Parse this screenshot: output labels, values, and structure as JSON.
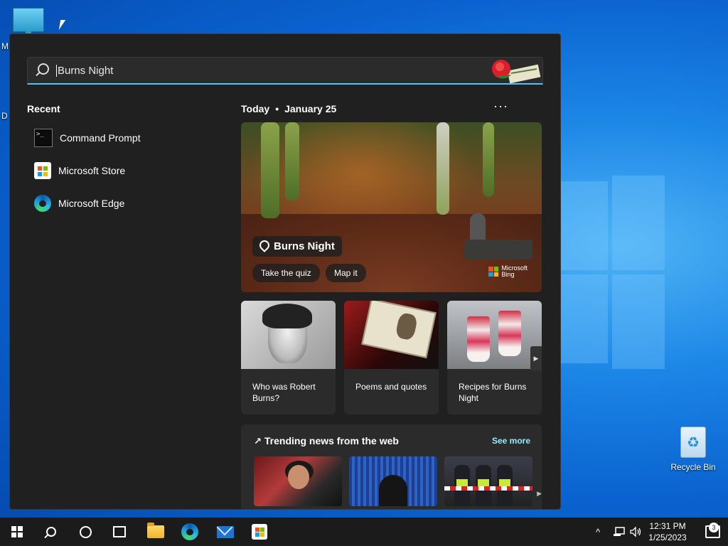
{
  "desktop": {
    "edge_letters": [
      "M",
      "D"
    ],
    "recycle_bin_label": "Recycle Bin"
  },
  "search": {
    "query": "Burns Night"
  },
  "recent": {
    "title": "Recent",
    "items": [
      {
        "label": "Command Prompt",
        "icon": "command-prompt-icon"
      },
      {
        "label": "Microsoft Store",
        "icon": "microsoft-store-icon"
      },
      {
        "label": "Microsoft Edge",
        "icon": "microsoft-edge-icon"
      }
    ]
  },
  "today": {
    "label": "Today",
    "separator": "•",
    "date": "January 25",
    "more": "···"
  },
  "hero": {
    "title": "Burns Night",
    "buttons": [
      "Take the quiz",
      "Map it"
    ],
    "brand_line1": "Microsoft",
    "brand_line2": "Bing"
  },
  "cards": [
    {
      "label": "Who was Robert Burns?"
    },
    {
      "label": "Poems and quotes"
    },
    {
      "label": "Recipes for Burns Night"
    }
  ],
  "trending": {
    "title": "Trending news from the web",
    "see_more": "See more"
  },
  "taskbar": {
    "time": "12:31 PM",
    "date": "1/25/2023",
    "notification_count": "3"
  },
  "colors": {
    "accent": "#4cc2ff",
    "link": "#99ebff",
    "panel_bg": "#202020",
    "card_bg": "#2b2b2b",
    "taskbar_bg": "#1b1b1b"
  }
}
